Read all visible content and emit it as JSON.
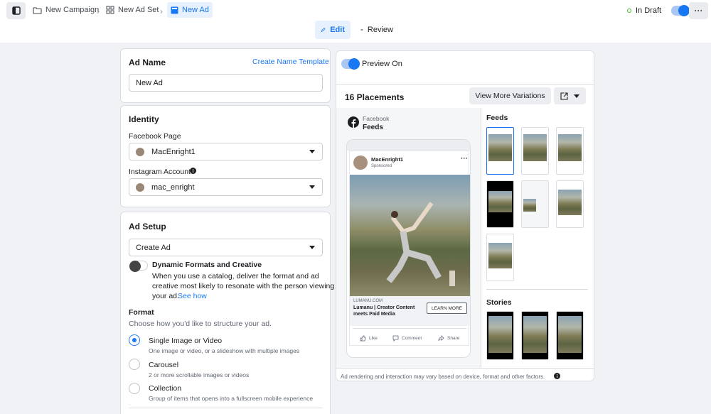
{
  "breadcrumb": {
    "campaign": "New Campaign",
    "adset": "New Ad Set",
    "ad": "New Ad"
  },
  "status": {
    "label": "In Draft",
    "draft_toggle_on": true
  },
  "tabs": {
    "edit": "Edit",
    "review": "Review"
  },
  "ad_name": {
    "heading": "Ad Name",
    "template_link": "Create Name Template",
    "value": "New Ad"
  },
  "identity": {
    "heading": "Identity",
    "facebook_page_label": "Facebook Page",
    "facebook_page_value": "MacEnright1",
    "instagram_label": "Instagram Account",
    "instagram_value": "mac_enright"
  },
  "ad_setup": {
    "heading": "Ad Setup",
    "select_value": "Create Ad",
    "dynamic_title": "Dynamic Formats and Creative",
    "dynamic_desc_1": "When you use a catalog, deliver the format and ad",
    "dynamic_desc_2": "creative most likely to resonate with the person viewing",
    "dynamic_desc_3": "your ad.",
    "see_how": "See how",
    "format_heading": "Format",
    "format_sub": "Choose how you'd like to structure your ad.",
    "options": [
      {
        "title": "Single Image or Video",
        "desc": "One image or video, or a slideshow with multiple images",
        "selected": true
      },
      {
        "title": "Carousel",
        "desc": "2 or more scrollable images or videos",
        "selected": false
      },
      {
        "title": "Collection",
        "desc": "Group of items that opens into a fullscreen mobile experience",
        "selected": false
      }
    ]
  },
  "preview": {
    "toggle_label": "Preview On",
    "placements_title": "16 Placements",
    "more_variations": "View More Variations",
    "platform": "Facebook",
    "placement": "Feeds",
    "post": {
      "page_name": "MacEnright1",
      "sponsored": "Sponsored",
      "domain": "LUMANU.COM",
      "headline_1": "Lumanu | Creator Content",
      "headline_2": "meets Paid Media",
      "cta": "LEARN MORE",
      "like": "Like",
      "comment": "Comment",
      "share": "Share"
    },
    "feeds_label": "Feeds",
    "stories_label": "Stories",
    "disclaimer": "Ad rendering and interaction may vary based on device, format and other factors."
  },
  "colors": {
    "accent": "#1877f2",
    "draft_dot": "#42b72a"
  }
}
